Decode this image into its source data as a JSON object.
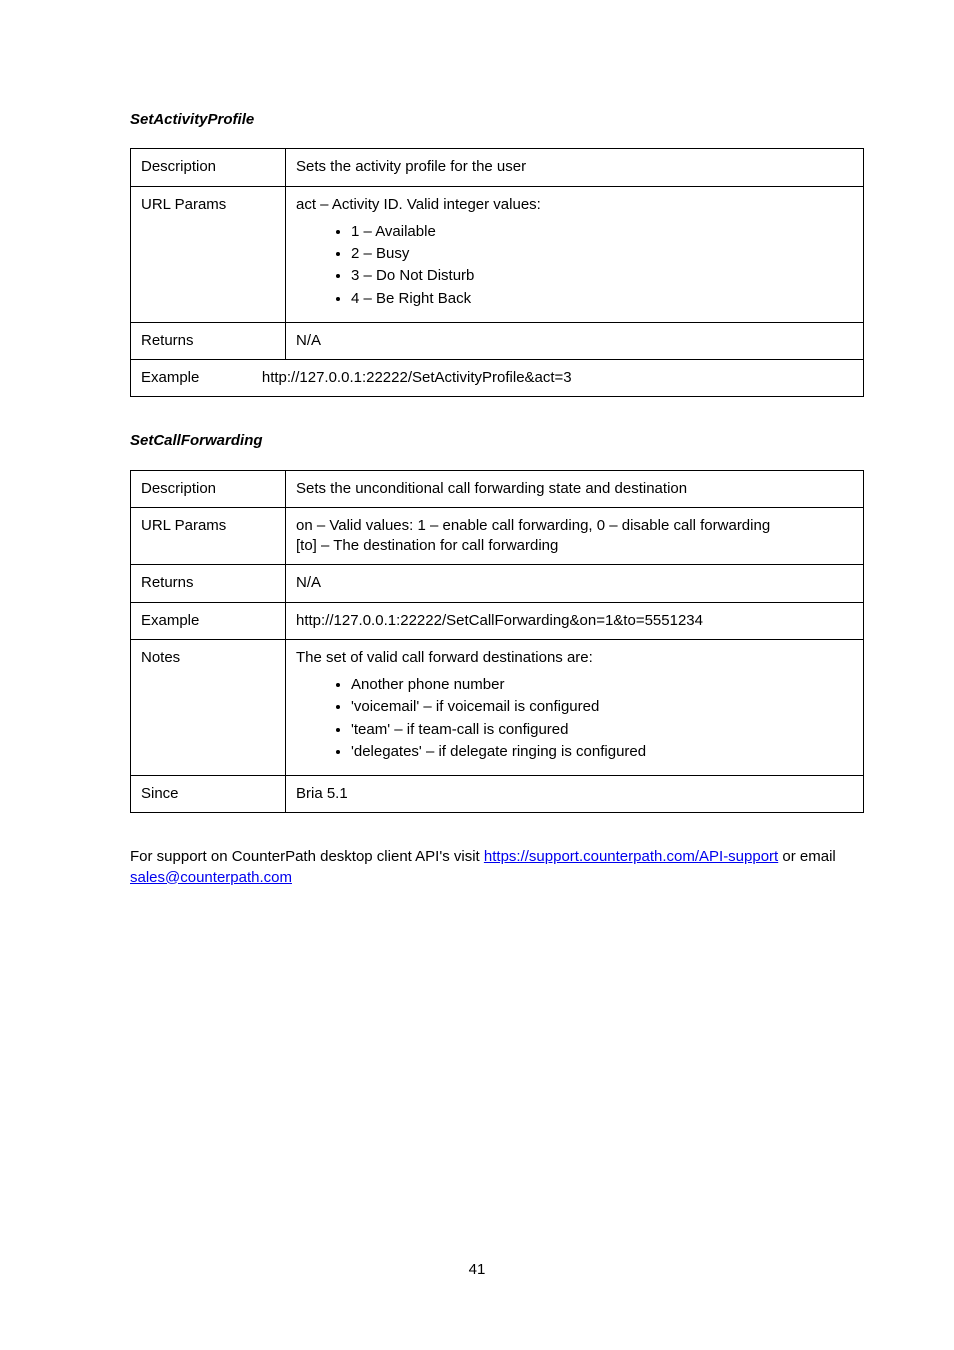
{
  "section1": {
    "heading": "SetActivityProfile",
    "rows": [
      {
        "label": "Description",
        "value": "Sets the activity profile for the user"
      },
      {
        "label": "URL Params",
        "intro": "act – Activity ID. Valid integer values:",
        "options": [
          "1 – Available",
          "2 – Busy",
          "3 – Do Not Disturb",
          "4 – Be Right Back"
        ]
      },
      {
        "label": "Returns",
        "value": "N/A"
      },
      {
        "label": "Example",
        "value": "http://127.0.0.1:22222/SetActivityProfile&act=3",
        "colspan": true
      }
    ]
  },
  "section2": {
    "heading": "SetCallForwarding",
    "rows": [
      {
        "label": "Description",
        "value": "Sets the unconditional call forwarding state and destination"
      },
      {
        "label": "URL Params",
        "value_lines": [
          "on – Valid values: 1 – enable call forwarding, 0 – disable call forwarding",
          "[to] – The destination for call forwarding"
        ]
      },
      {
        "label": "Returns",
        "value": "N/A"
      },
      {
        "label": "Example",
        "value": "http://127.0.0.1:22222/SetCallForwarding&on=1&to=5551234"
      },
      {
        "label": "Notes",
        "intro": "The set of valid call forward destinations are:",
        "options": [
          "Another phone number",
          "'voicemail' – if voicemail is configured",
          "'team' – if team-call is configured",
          "'delegates' – if delegate ringing is configured"
        ]
      },
      {
        "label": "Since",
        "value": "Bria 5.1"
      }
    ]
  },
  "footer": {
    "text_before": "For support on CounterPath desktop client API's visit ",
    "link1": "https://support.counterpath.com/API-support",
    "text_mid": " or email ",
    "link2": "sales@counterpath.com"
  },
  "page_number": "41"
}
